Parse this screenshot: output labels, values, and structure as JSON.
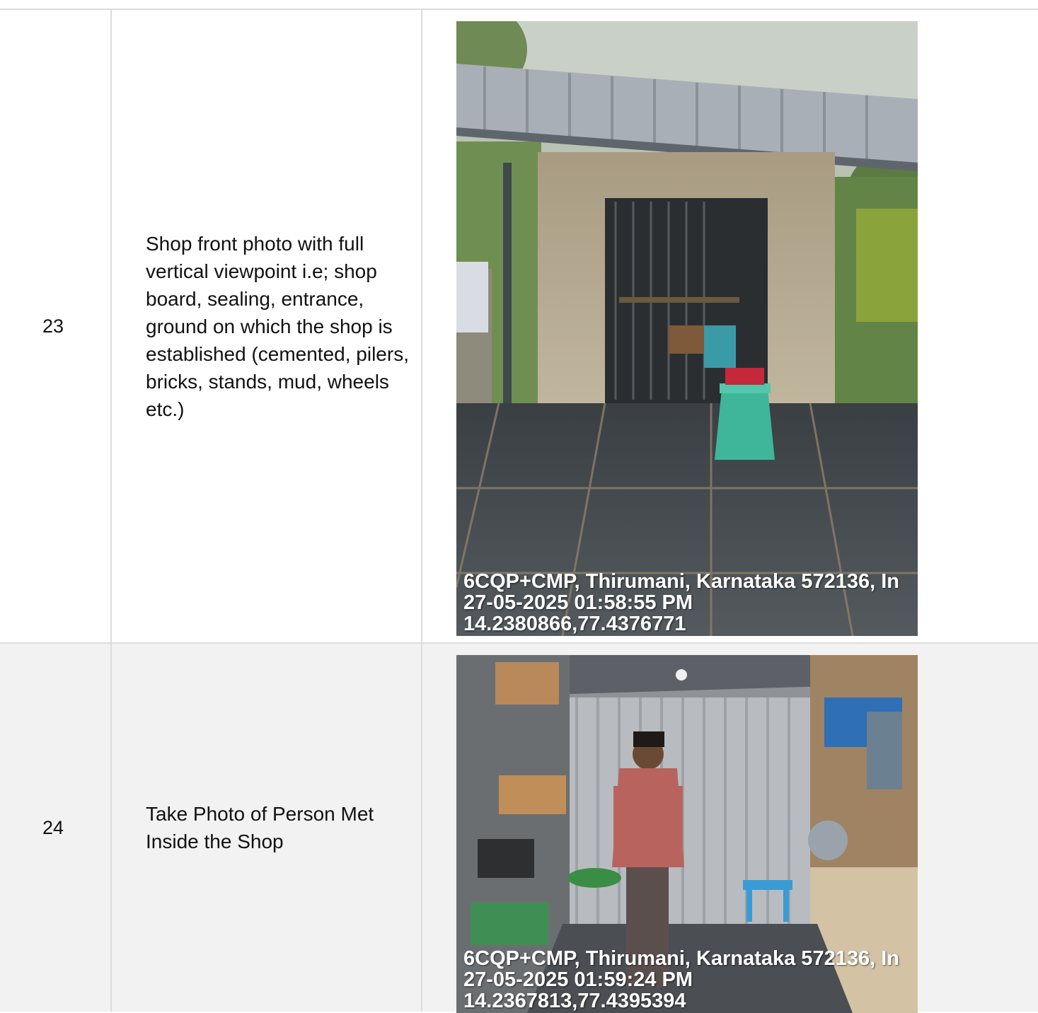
{
  "rows": [
    {
      "number": "23",
      "description": "Shop front photo with full vertical viewpoint i.e; shop board, sealing, entrance, ground on which the shop is established (cemented, pilers, bricks, stands, mud, wheels etc.)",
      "photo_subject": "shop-front",
      "stamp": {
        "address": "6CQP+CMP, Thirumani, Karnataka 572136, In",
        "datetime": "27-05-2025 01:58:55 PM",
        "coordinates": "14.2380866,77.4376771"
      }
    },
    {
      "number": "24",
      "description": "Take Photo of Person Met Inside the Shop",
      "photo_subject": "person-inside-shop",
      "stamp": {
        "address": "6CQP+CMP, Thirumani, Karnataka 572136, In",
        "datetime": "27-05-2025 01:59:24 PM",
        "coordinates": "14.2367813,77.4395394"
      }
    }
  ]
}
